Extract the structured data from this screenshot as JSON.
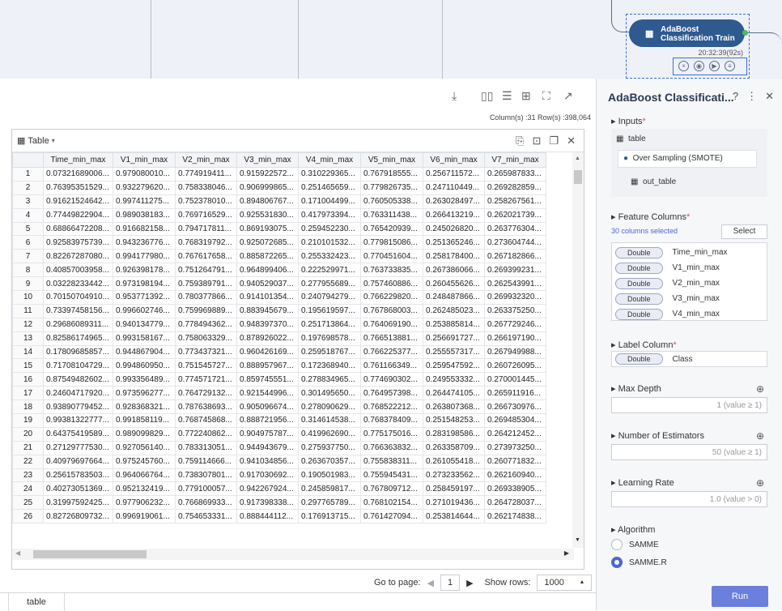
{
  "canvas": {
    "node_title_line1": "AdaBoost",
    "node_title_line2": "Classification Train",
    "node_time": "20:32:39(92s)"
  },
  "toolbar": {
    "download_icon": "download-icon",
    "columns_info": "Column(s) :31   Row(s) :398,064"
  },
  "grid": {
    "title": "Table",
    "columns": [
      "Time_min_max",
      "V1_min_max",
      "V2_min_max",
      "V3_min_max",
      "V4_min_max",
      "V5_min_max",
      "V6_min_max",
      "V7_min_max"
    ],
    "rows": [
      [
        "1",
        "0.07321689006...",
        "0.979080010...",
        "0.774919411...",
        "0.915922572...",
        "0.310229365...",
        "0.767918555...",
        "0.256711572...",
        "0.265987833..."
      ],
      [
        "2",
        "0.76395351529...",
        "0.932279620...",
        "0.758338046...",
        "0.906999865...",
        "0.251465659...",
        "0.779826735...",
        "0.247110449...",
        "0.269282859..."
      ],
      [
        "3",
        "0.91621524642...",
        "0.997411275...",
        "0.752378010...",
        "0.894806767...",
        "0.171004499...",
        "0.760505338...",
        "0.263028497...",
        "0.258267561..."
      ],
      [
        "4",
        "0.77449822904...",
        "0.989038183...",
        "0.769716529...",
        "0.925531830...",
        "0.417973394...",
        "0.763311438...",
        "0.266413219...",
        "0.262021739..."
      ],
      [
        "5",
        "0.68866472208...",
        "0.916682158...",
        "0.794717811...",
        "0.869193075...",
        "0.259452230...",
        "0.765420939...",
        "0.245026820...",
        "0.263776304..."
      ],
      [
        "6",
        "0.92583975739...",
        "0.943236776...",
        "0.768319792...",
        "0.925072685...",
        "0.210101532...",
        "0.779815086...",
        "0.251365246...",
        "0.273604744..."
      ],
      [
        "7",
        "0.82267287080...",
        "0.994177980...",
        "0.767617658...",
        "0.885872265...",
        "0.255332423...",
        "0.770451604...",
        "0.258178400...",
        "0.267182866..."
      ],
      [
        "8",
        "0.40857003958...",
        "0.926398178...",
        "0.751264791...",
        "0.964899406...",
        "0.222529971...",
        "0.763733835...",
        "0.267386066...",
        "0.269399231..."
      ],
      [
        "9",
        "0.03228233442...",
        "0.973198194...",
        "0.759389791...",
        "0.940529037...",
        "0.277955689...",
        "0.757460886...",
        "0.260455626...",
        "0.262543991..."
      ],
      [
        "10",
        "0.70150704910...",
        "0.953771392...",
        "0.780377866...",
        "0.914101354...",
        "0.240794279...",
        "0.766229820...",
        "0.248487866...",
        "0.269932320..."
      ],
      [
        "11",
        "0.73397458156...",
        "0.996602746...",
        "0.759969889...",
        "0.883945679...",
        "0.195619597...",
        "0.767868003...",
        "0.262485023...",
        "0.263375250..."
      ],
      [
        "12",
        "0.29686089311...",
        "0.940134779...",
        "0.778494362...",
        "0.948397370...",
        "0.251713864...",
        "0.764069190...",
        "0.253885814...",
        "0.267729246..."
      ],
      [
        "13",
        "0.82586174965...",
        "0.993158167...",
        "0.758063329...",
        "0.878926022...",
        "0.197698578...",
        "0.766513881...",
        "0.256691727...",
        "0.266197190..."
      ],
      [
        "14",
        "0.17809685857...",
        "0.944867904...",
        "0.773437321...",
        "0.960426169...",
        "0.259518767...",
        "0.766225377...",
        "0.255557317...",
        "0.267949988..."
      ],
      [
        "15",
        "0.71708104729...",
        "0.994860950...",
        "0.751545727...",
        "0.888957967...",
        "0.172368940...",
        "0.761166349...",
        "0.259547592...",
        "0.260726095..."
      ],
      [
        "16",
        "0.87549482602...",
        "0.993356489...",
        "0.774571721...",
        "0.859745551...",
        "0.278834965...",
        "0.774690302...",
        "0.249553332...",
        "0.270001445..."
      ],
      [
        "17",
        "0.24604717920...",
        "0.973596277...",
        "0.764729132...",
        "0.921544996...",
        "0.301495650...",
        "0.764957398...",
        "0.264474105...",
        "0.265911916..."
      ],
      [
        "18",
        "0.93890779452...",
        "0.928368321...",
        "0.787638693...",
        "0.905096674...",
        "0.278090629...",
        "0.768522212...",
        "0.263807368...",
        "0.266730976..."
      ],
      [
        "19",
        "0.99381322777...",
        "0.991858119...",
        "0.768745868...",
        "0.888721956...",
        "0.314614538...",
        "0.768378409...",
        "0.251548253...",
        "0.269485304..."
      ],
      [
        "20",
        "0.64375419589...",
        "0.989099829...",
        "0.772240862...",
        "0.904975787...",
        "0.419962690...",
        "0.775175016...",
        "0.283198586...",
        "0.264212452..."
      ],
      [
        "21",
        "0.27129777530...",
        "0.927056140...",
        "0.783313051...",
        "0.944943679...",
        "0.275937750...",
        "0.766363832...",
        "0.263358709...",
        "0.273973250..."
      ],
      [
        "22",
        "0.40979697664...",
        "0.975245760...",
        "0.759114666...",
        "0.941034856...",
        "0.263670357...",
        "0.755838311...",
        "0.261055418...",
        "0.260771832..."
      ],
      [
        "23",
        "0.25615783503...",
        "0.964066764...",
        "0.738307801...",
        "0.917030692...",
        "0.190501983...",
        "0.755945431...",
        "0.273233562...",
        "0.262160940..."
      ],
      [
        "24",
        "0.40273051369...",
        "0.952132419...",
        "0.779100057...",
        "0.942267924...",
        "0.245859817...",
        "0.767809712...",
        "0.258459197...",
        "0.269338905..."
      ],
      [
        "25",
        "0.31997592425...",
        "0.977906232...",
        "0.766869933...",
        "0.917398338...",
        "0.297765789...",
        "0.768102154...",
        "0.271019436...",
        "0.264728037..."
      ],
      [
        "26",
        "0.82726809732...",
        "0.996919061...",
        "0.754653331...",
        "0.888444112...",
        "0.176913715...",
        "0.761427094...",
        "0.253814644...",
        "0.262174838..."
      ]
    ]
  },
  "pager": {
    "go_to_label": "Go to page:",
    "page": "1",
    "show_rows_label": "Show rows:",
    "rows_value": "1000"
  },
  "bottom_tab": "table",
  "panel": {
    "title": "AdaBoost Classificati...",
    "inputs_label": "Inputs",
    "input_table": "table",
    "source_node": "Over Sampling (SMOTE)",
    "out_table": "out_table",
    "feature_label": "Feature Columns",
    "selected_count": "30 columns selected",
    "select_btn": "Select",
    "features": [
      {
        "type": "Double",
        "name": "Time_min_max"
      },
      {
        "type": "Double",
        "name": "V1_min_max"
      },
      {
        "type": "Double",
        "name": "V2_min_max"
      },
      {
        "type": "Double",
        "name": "V3_min_max"
      },
      {
        "type": "Double",
        "name": "V4_min_max"
      }
    ],
    "label_col_label": "Label Column",
    "label_type": "Double",
    "label_name": "Class",
    "max_depth_label": "Max Depth",
    "max_depth_hint": "1 (value ≥ 1)",
    "n_estimators_label": "Number of Estimators",
    "n_estimators_hint": "50 (value ≥ 1)",
    "lr_label": "Learning Rate",
    "lr_hint": "1.0 (value > 0)",
    "algorithm_label": "Algorithm",
    "alg_opt1": "SAMME",
    "alg_opt2": "SAMME.R",
    "run_label": "Run"
  },
  "colors": {
    "accent": "#4a67d6",
    "node": "#2f5a8f",
    "run": "#6b7fdc"
  }
}
